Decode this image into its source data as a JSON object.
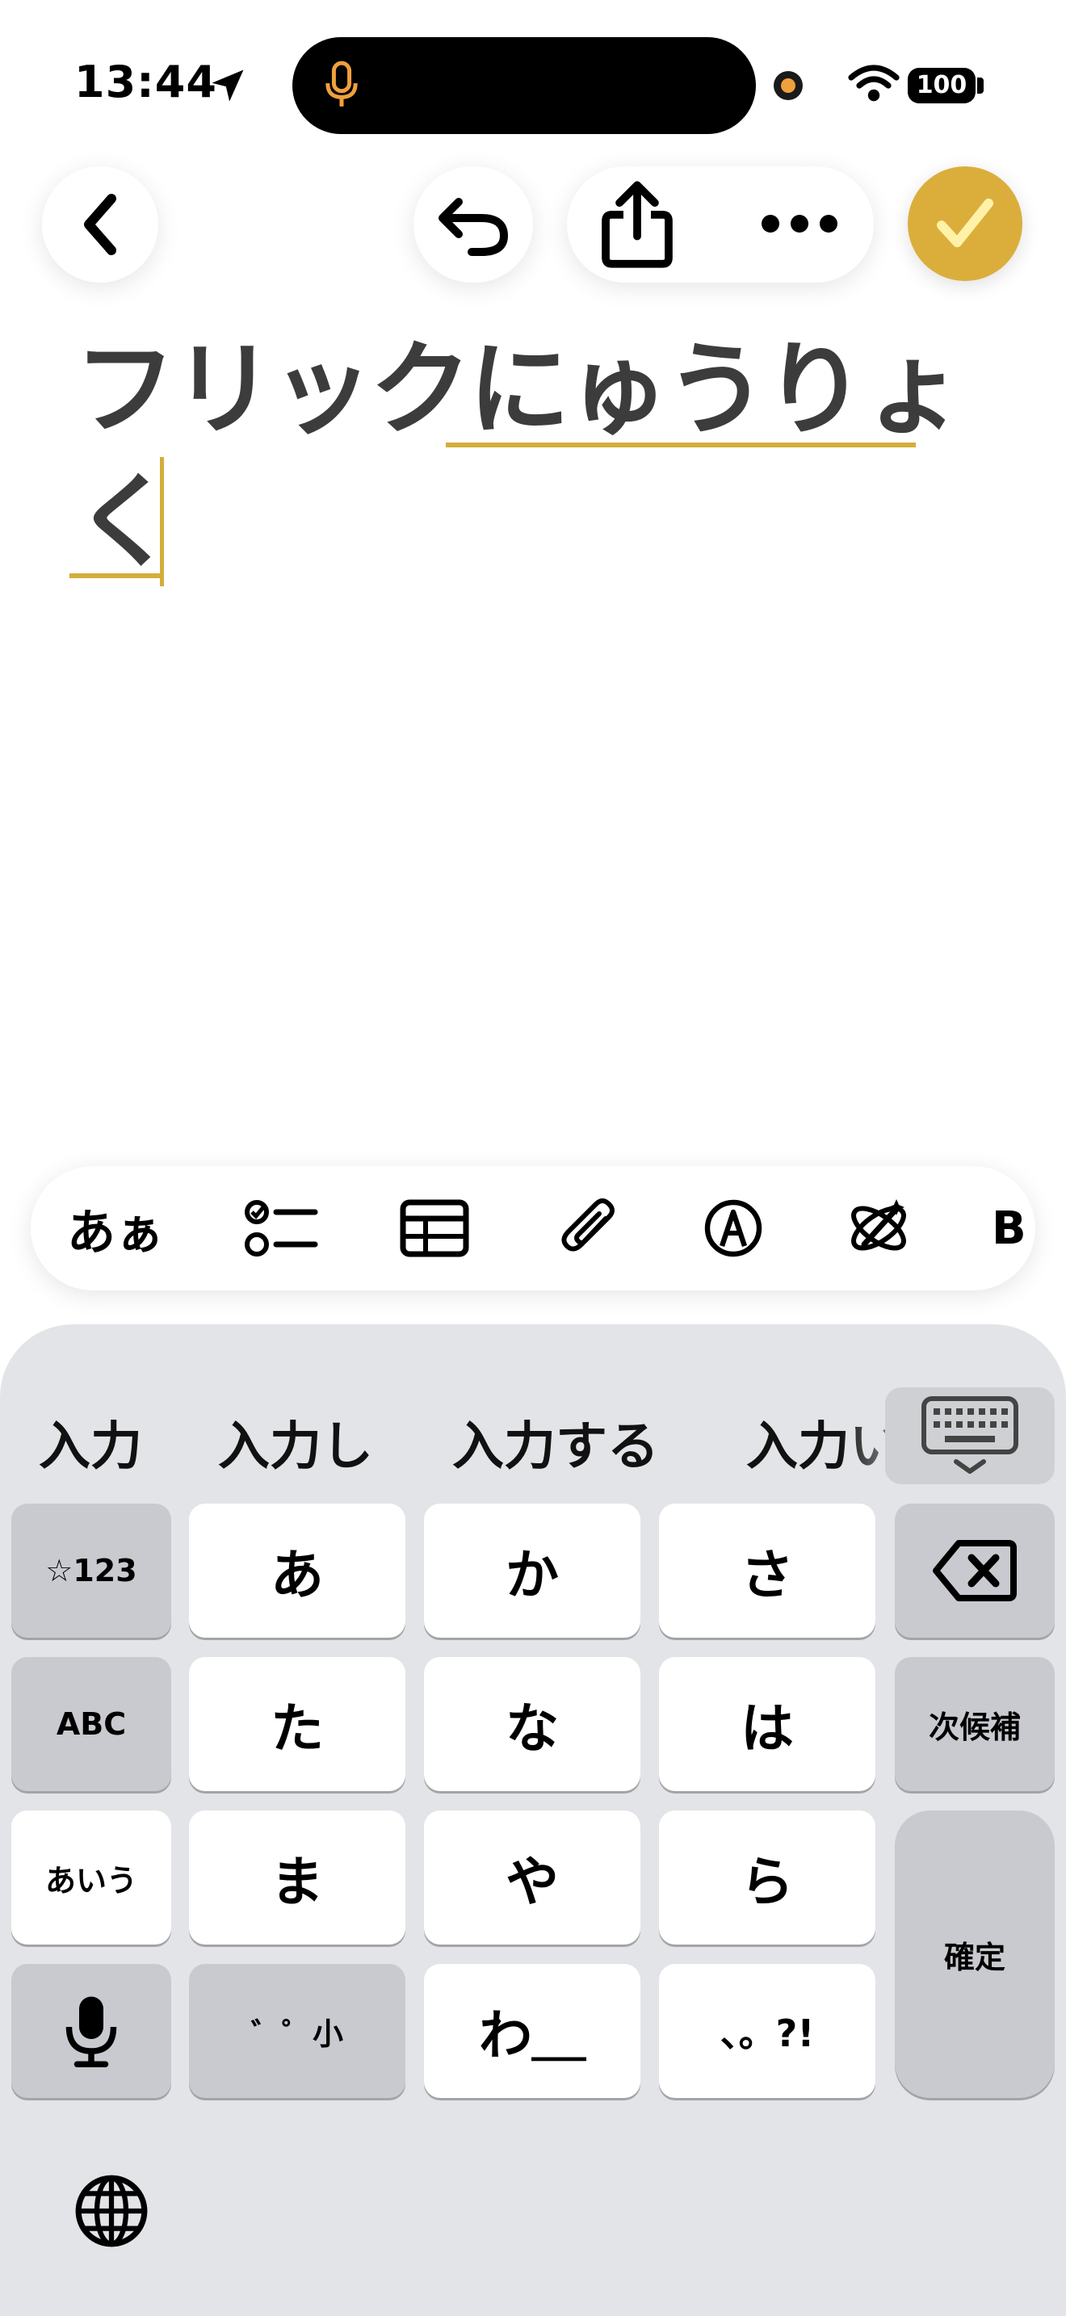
{
  "status_bar": {
    "time": "13:44",
    "battery": "100"
  },
  "colors": {
    "accent": "#dbae3c",
    "keyboard_bg": "#e3e4e8",
    "key_dark": "#c9cacf",
    "text_dark": "#3c3c3c"
  },
  "toolbar": {
    "back_icon": "chevron-left-icon",
    "undo_icon": "undo-icon",
    "share_icon": "share-icon",
    "more_icon": "ellipsis-icon",
    "done_icon": "checkmark-icon"
  },
  "note": {
    "line1_committed": "フリック",
    "line1_composing": "にゅうりょ",
    "line2_composing": "く"
  },
  "format_bar": {
    "items": [
      {
        "label": "あぁ",
        "icon": "text-format-icon"
      },
      {
        "label": "",
        "icon": "checklist-icon"
      },
      {
        "label": "",
        "icon": "table-icon"
      },
      {
        "label": "",
        "icon": "paperclip-icon"
      },
      {
        "label": "",
        "icon": "markup-pen-icon"
      },
      {
        "label": "",
        "icon": "writing-tools-icon"
      }
    ]
  },
  "keyboard": {
    "candidates": [
      "入力",
      "入力し",
      "入力する",
      "入力い"
    ],
    "keys": {
      "symbols": "☆123",
      "abc": "ABC",
      "kana_mode": "あいう",
      "a": "あ",
      "ka": "か",
      "sa": "さ",
      "ta": "た",
      "na": "な",
      "ha": "は",
      "ma": "ま",
      "ya": "や",
      "ra": "ら",
      "dakuten": "゛゜小",
      "wa": "わ＿",
      "punct": "、。?!",
      "next_candidate": "次候補",
      "confirm": "確定"
    }
  }
}
